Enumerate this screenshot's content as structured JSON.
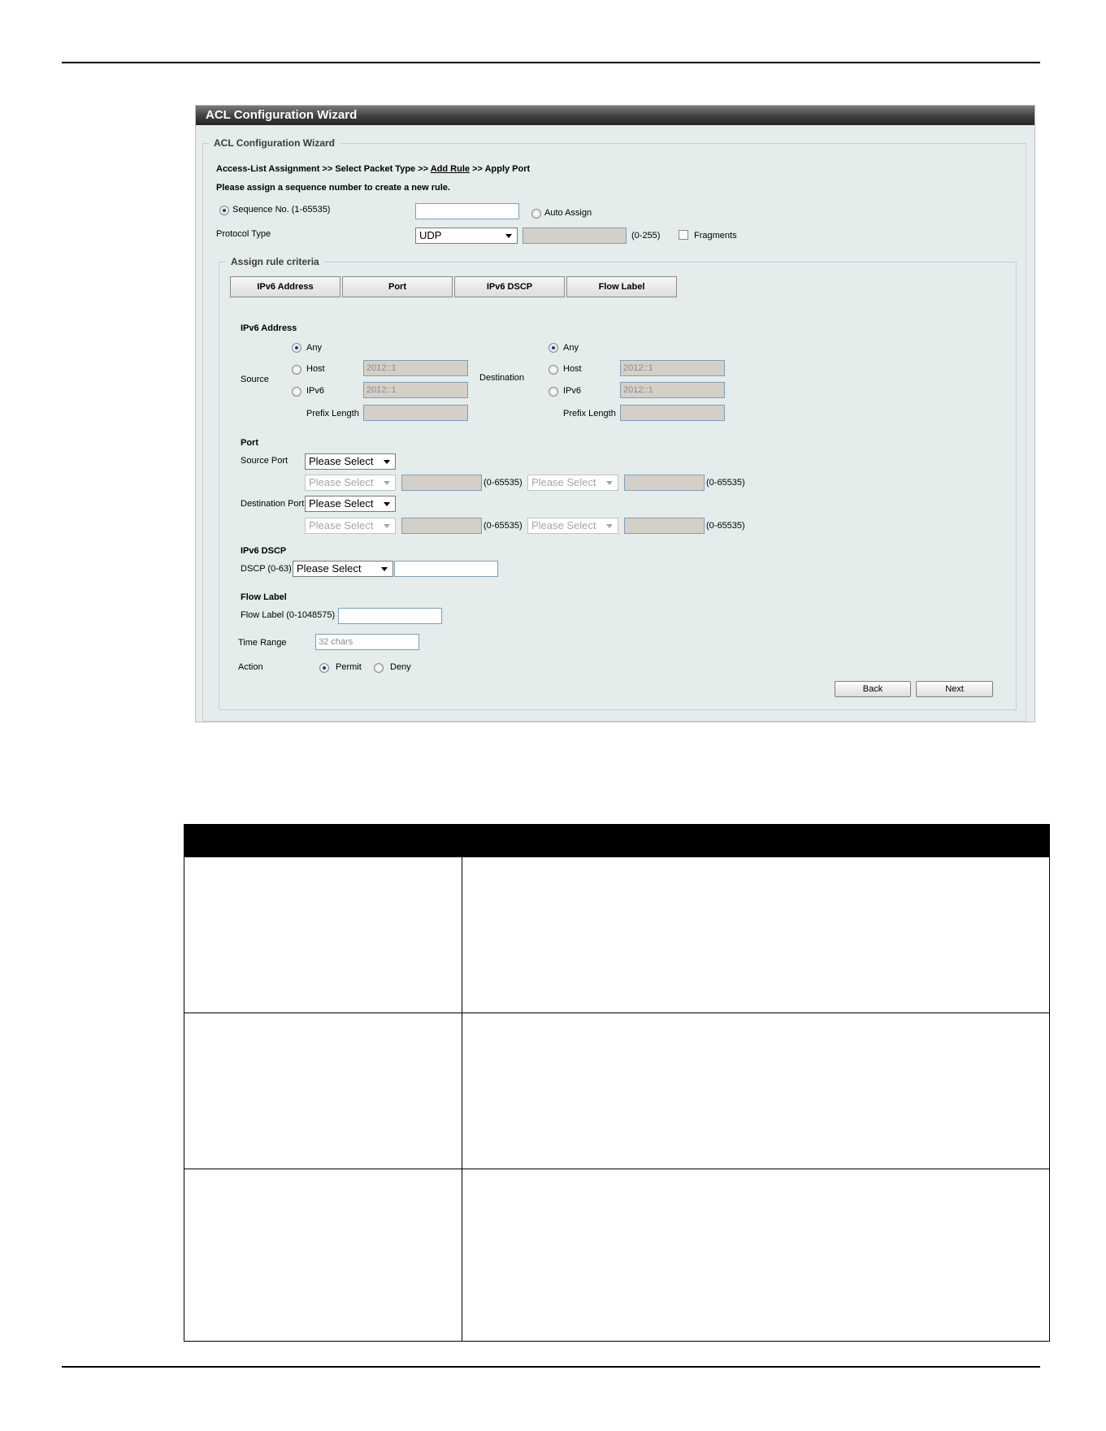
{
  "wizard": {
    "title": "ACL Configuration Wizard",
    "legend": "ACL Configuration Wizard",
    "steps": {
      "step1": "Access-List Assignment >> Select Packet Type >>",
      "current": "Add Rule",
      "step4": ">> Apply Port"
    },
    "prompt": "Please assign a sequence number to create a new rule.",
    "sequence": {
      "label": "Sequence No. (1-65535)",
      "value": "",
      "auto_assign_label": "Auto Assign",
      "selected": "sequence"
    },
    "protocol": {
      "label": "Protocol Type",
      "selected": "UDP",
      "range": "(0-255)",
      "fragments_label": "Fragments"
    },
    "criteria": {
      "legend": "Assign rule criteria",
      "tabs": [
        "IPv6 Address",
        "Port",
        "IPv6 DSCP",
        "Flow Label"
      ]
    },
    "ipv6_address": {
      "heading": "IPv6 Address",
      "source_label": "Source",
      "destination_label": "Destination",
      "any_label": "Any",
      "host_label": "Host",
      "ipv6_label": "IPv6",
      "prefix_label": "Prefix Length",
      "source_host_placeholder": "2012::1",
      "source_ipv6_placeholder": "2012::1",
      "dest_host_placeholder": "2012::1",
      "dest_ipv6_placeholder": "2012::1"
    },
    "port": {
      "heading": "Port",
      "source_label": "Source Port",
      "destination_label": "Destination Port",
      "select_default": "Please Select",
      "range": "(0-65535)"
    },
    "dscp": {
      "heading": "IPv6 DSCP",
      "label": "DSCP (0-63)",
      "select_default": "Please Select"
    },
    "flow_label": {
      "heading": "Flow Label",
      "label": "Flow Label (0-1048575)"
    },
    "time_range": {
      "label": "Time Range",
      "placeholder": "32 chars"
    },
    "action": {
      "label": "Action",
      "permit": "Permit",
      "deny": "Deny",
      "selected": "permit"
    },
    "buttons": {
      "back": "Back",
      "next": "Next"
    }
  },
  "colors": {
    "panel_bg": "#e5ecec",
    "title_bar": "#3f3f3f",
    "disabled_input": "#d4d0c8"
  },
  "table": {
    "columns": [
      "",
      ""
    ],
    "rows": [
      [
        "",
        ""
      ],
      [
        "",
        ""
      ],
      [
        "",
        ""
      ]
    ]
  }
}
